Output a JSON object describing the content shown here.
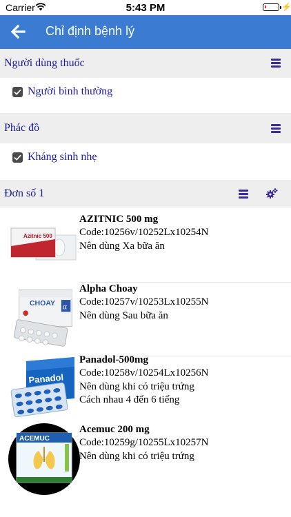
{
  "status_bar": {
    "carrier": "Carrier",
    "time": "5:43 PM",
    "battery_level": 0.1
  },
  "nav": {
    "title": "Chỉ định bệnh lý",
    "back_icon": "back-arrow-icon"
  },
  "sections": {
    "user": {
      "title": "Người dùng thuốc",
      "option": "Người bình thường",
      "checked": true
    },
    "regimen": {
      "title": "Phác đồ",
      "option": "Kháng sinh nhẹ",
      "checked": true
    }
  },
  "prescription": {
    "title": "Đơn số 1",
    "drugs": [
      {
        "name": "AZITNIC 500 mg",
        "code": "Code:10256v/10252Lx10254N",
        "usage": [
          "Nên dùng Xa bữa ăn"
        ],
        "package_text": "Azitnic 500"
      },
      {
        "name": "Alpha Choay",
        "code": "Code:10257v/10253Lx10255N",
        "usage": [
          "Nên dùng Sau bữa ăn"
        ],
        "package_text": "CHOAY"
      },
      {
        "name": "Panadol-500mg",
        "code": "Code:10258v/10254Lx10256N",
        "usage": [
          "Nên dùng khi có triệu trứng",
          "Cách nhau 4 đến 6 tiếng"
        ],
        "package_text": "Panadol"
      },
      {
        "name": "Acemuc 200 mg",
        "code": "Code:10259g/10255Lx10257N",
        "usage": [
          "Nên dùng khi có triệu trứng"
        ],
        "package_text": "ACEMUC"
      }
    ]
  },
  "colors": {
    "nav_bg": "#3b7bd1",
    "link_text": "#1a1aa8",
    "section_bg": "#eeeeee",
    "icon_purple": "#3a2aa0"
  }
}
